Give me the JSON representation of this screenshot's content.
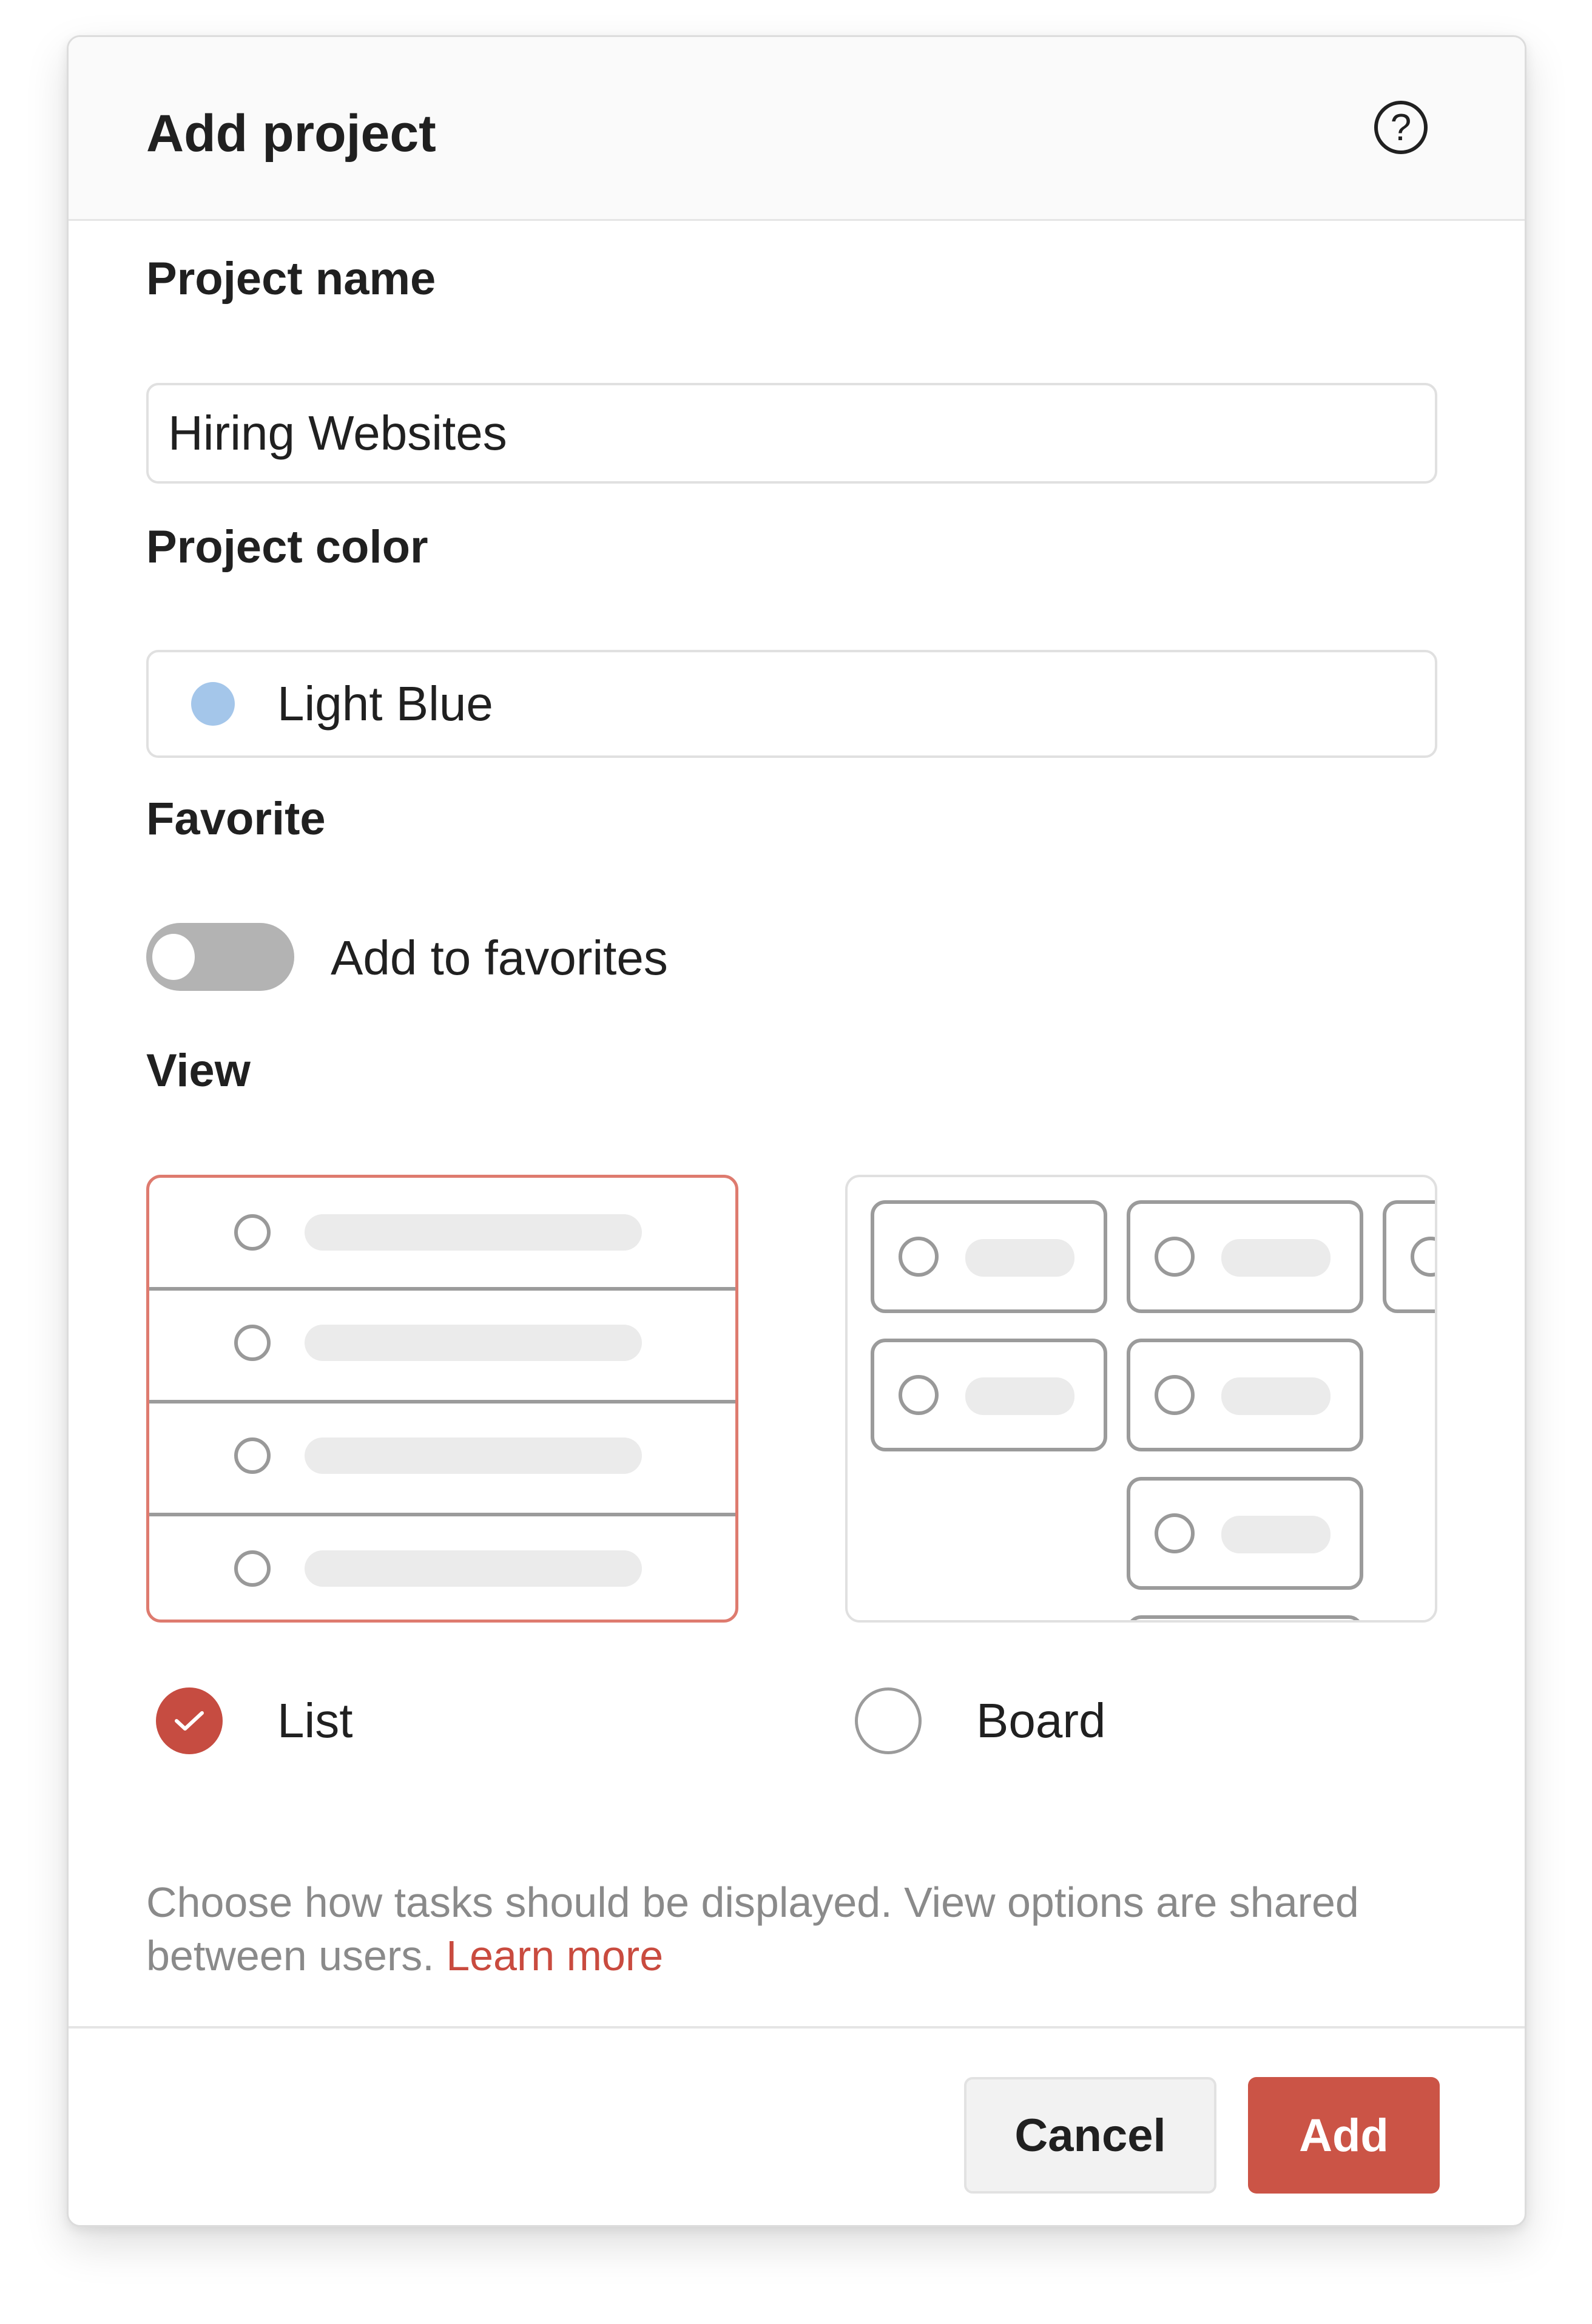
{
  "dialog": {
    "title": "Add project",
    "help_icon": "?"
  },
  "project_name": {
    "label": "Project name",
    "value": "Hiring Websites"
  },
  "project_color": {
    "label": "Project color",
    "selected": "Light Blue",
    "swatch": "#a4c6ea"
  },
  "favorite": {
    "label": "Favorite",
    "toggle_label": "Add to favorites",
    "enabled": false
  },
  "view": {
    "label": "View",
    "options": [
      {
        "label": "List",
        "selected": true
      },
      {
        "label": "Board",
        "selected": false
      }
    ],
    "hint": "Choose how tasks should be displayed. View options are shared between users.",
    "learn_more": "Learn more"
  },
  "footer": {
    "cancel_label": "Cancel",
    "add_label": "Add"
  },
  "colors": {
    "accent": "#cb5446",
    "list_border": "#de7b6f"
  }
}
